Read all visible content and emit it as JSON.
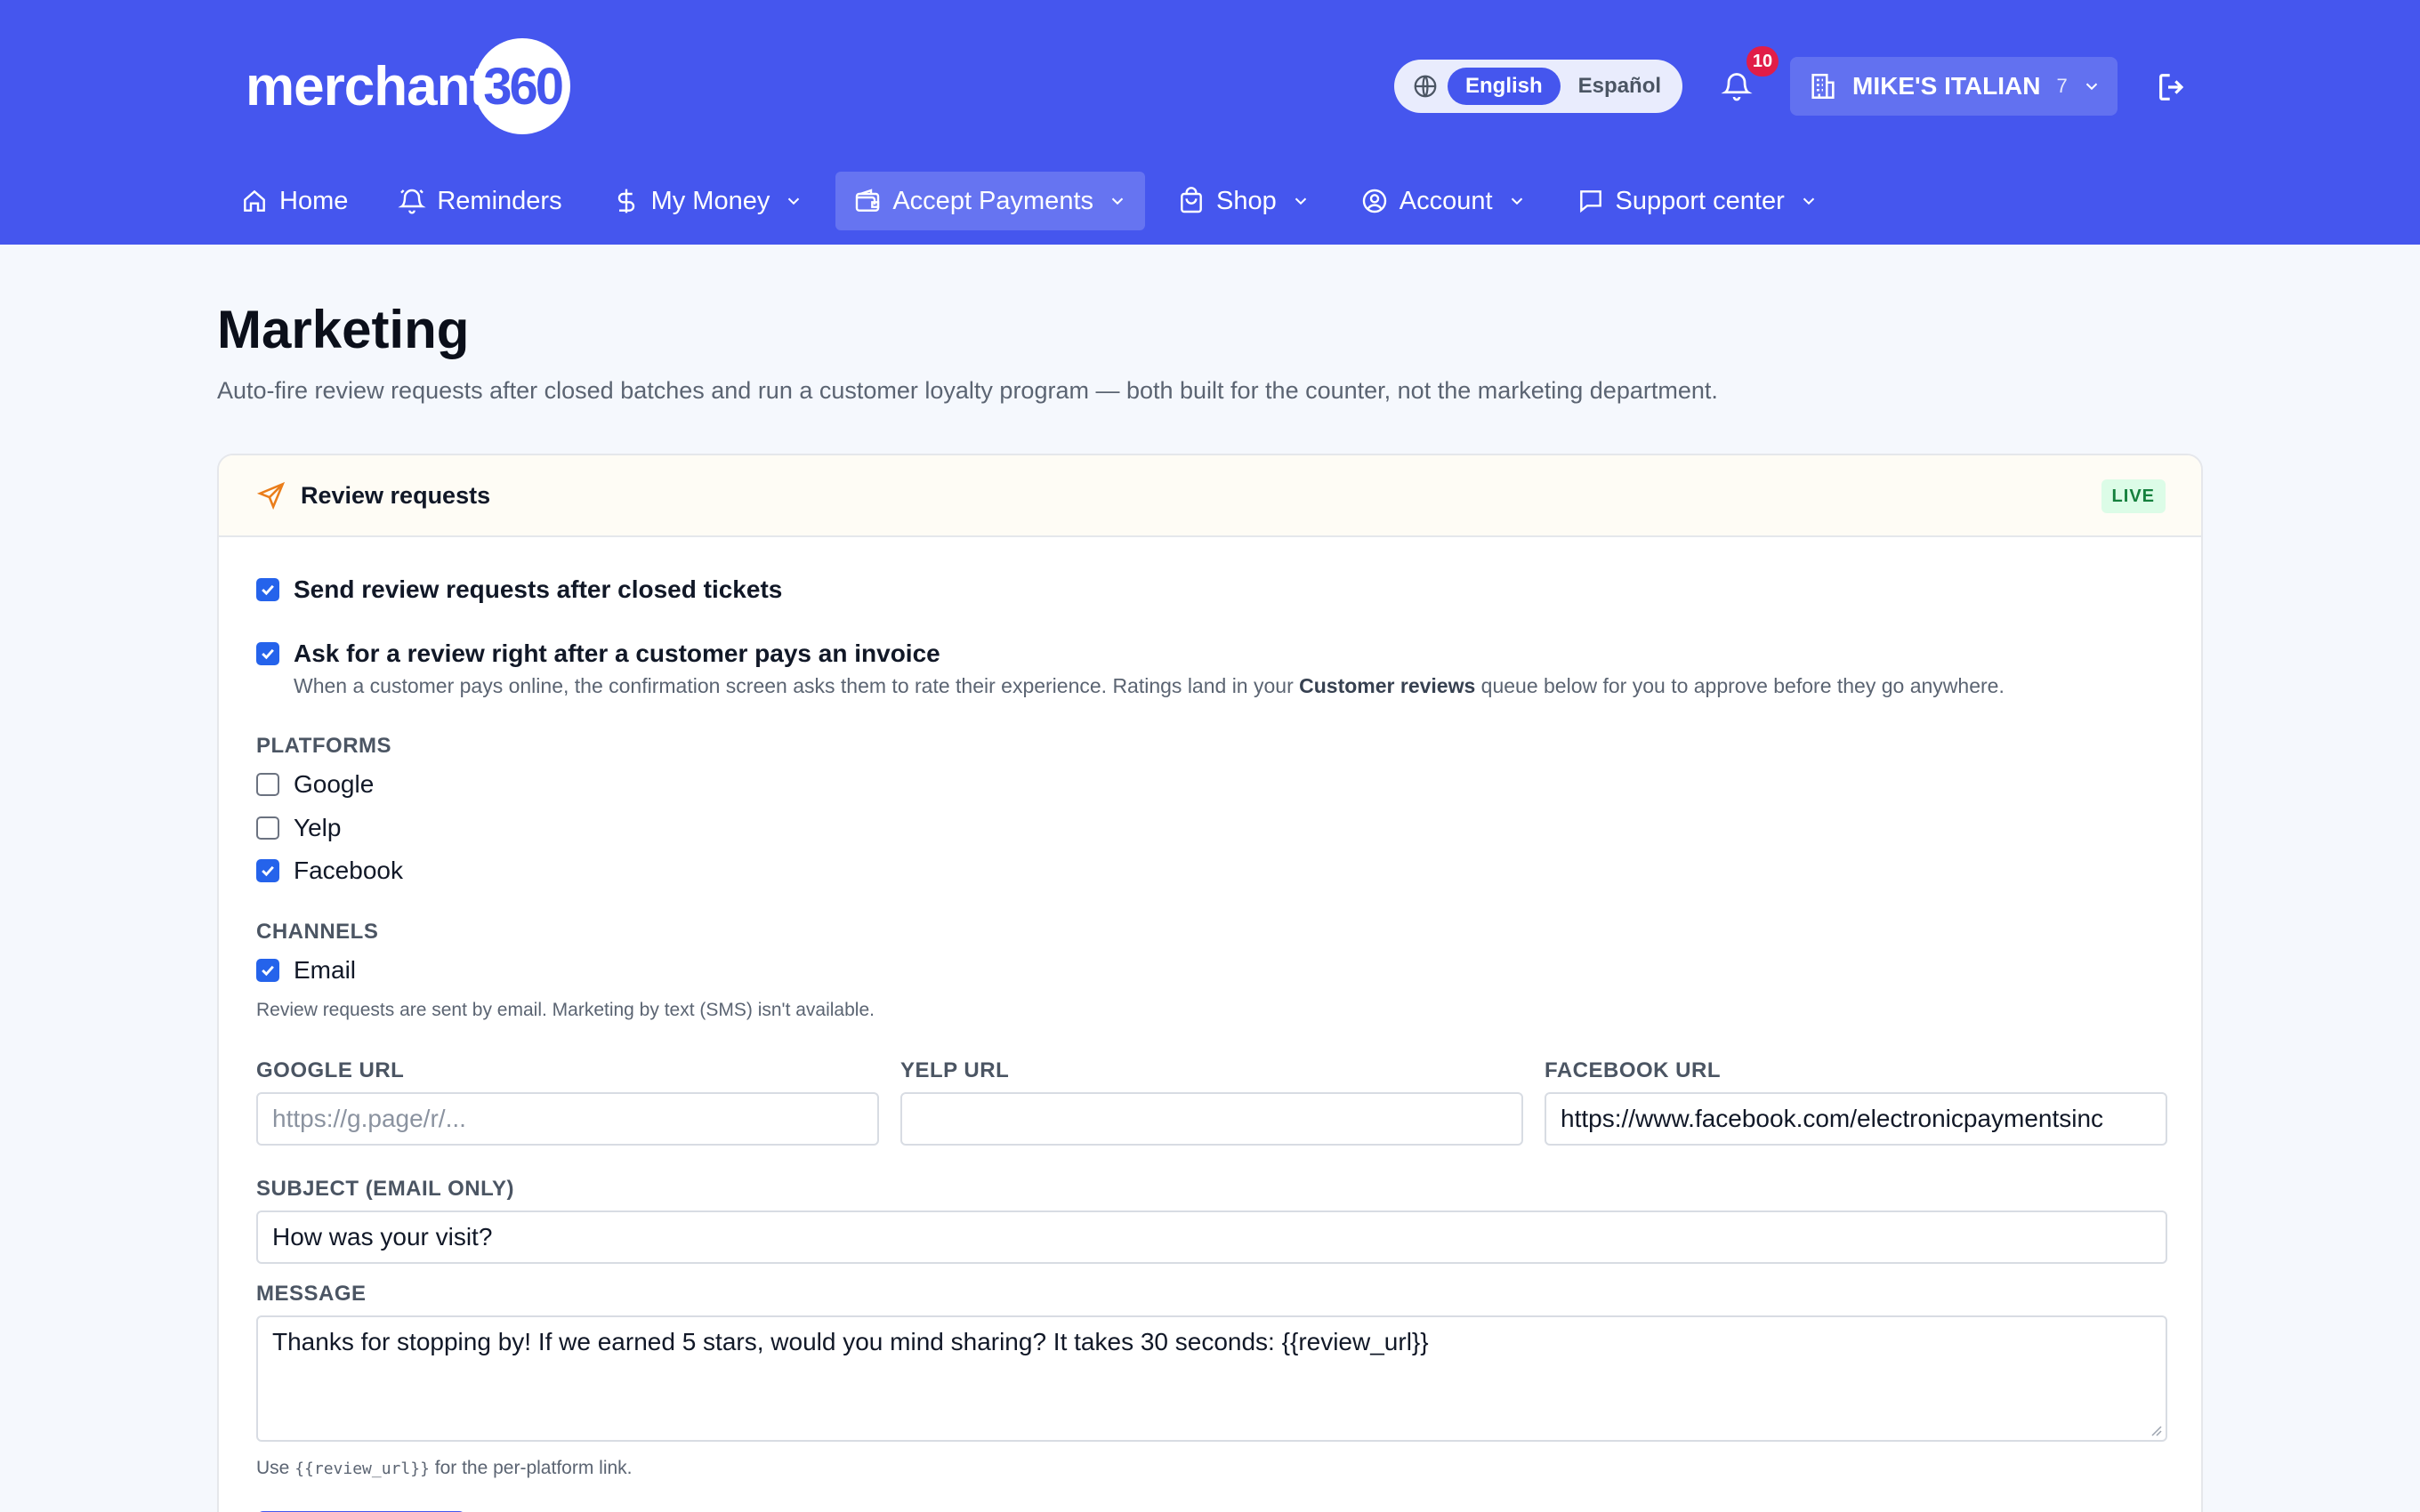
{
  "header": {
    "logo_text": "merchant",
    "logo_number": "360",
    "language": {
      "options": [
        "English",
        "Español"
      ],
      "selected": "English"
    },
    "notifications_count": "10",
    "store": {
      "name": "MIKE'S ITALIAN",
      "count": "7"
    },
    "icons": {
      "language": "globe-icon",
      "notifications": "bell-icon",
      "store": "building-icon",
      "logout": "logout-icon"
    }
  },
  "nav": {
    "items": [
      {
        "label": "Home",
        "icon": "home-icon",
        "dropdown": false
      },
      {
        "label": "Reminders",
        "icon": "bell-icon",
        "dropdown": false
      },
      {
        "label": "My Money",
        "icon": "dollar-icon",
        "dropdown": true
      },
      {
        "label": "Accept Payments",
        "icon": "wallet-icon",
        "dropdown": true,
        "active": true
      },
      {
        "label": "Shop",
        "icon": "bag-icon",
        "dropdown": true
      },
      {
        "label": "Account",
        "icon": "user-circle-icon",
        "dropdown": true
      },
      {
        "label": "Support center",
        "icon": "message-icon",
        "dropdown": true
      }
    ]
  },
  "page": {
    "title": "Marketing",
    "subtitle": "Auto-fire review requests after closed batches and run a customer loyalty program — both built for the counter, not the marketing department."
  },
  "review_card": {
    "title": "Review requests",
    "badge": "LIVE",
    "options": [
      {
        "label": "Send review requests after closed tickets",
        "checked": true
      },
      {
        "label": "Ask for a review right after a customer pays an invoice",
        "checked": true
      }
    ],
    "invoice_help_before": "When a customer pays online, the confirmation screen asks them to rate their experience. Ratings land in your ",
    "invoice_help_bold": "Customer reviews",
    "invoice_help_after": " queue below for you to approve before they go anywhere.",
    "platforms_heading": "PLATFORMS",
    "platforms": [
      {
        "label": "Google",
        "checked": false
      },
      {
        "label": "Yelp",
        "checked": false
      },
      {
        "label": "Facebook",
        "checked": true
      }
    ],
    "channels_heading": "CHANNELS",
    "channels": [
      {
        "label": "Email",
        "checked": true
      }
    ],
    "channels_note": "Review requests are sent by email. Marketing by text (SMS) isn't available.",
    "google_url": {
      "label": "GOOGLE URL",
      "value": "",
      "placeholder": "https://g.page/r/..."
    },
    "yelp_url": {
      "label": "YELP URL",
      "value": "",
      "placeholder": ""
    },
    "facebook_url": {
      "label": "FACEBOOK URL",
      "value": "https://www.facebook.com/electronicpaymentsinc",
      "placeholder": ""
    },
    "subject": {
      "label": "SUBJECT (EMAIL ONLY)",
      "value": "How was your visit?"
    },
    "message": {
      "label": "MESSAGE",
      "value": "Thanks for stopping by! If we earned 5 stars, would you mind sharing? It takes 30 seconds: {{review_url}}"
    },
    "message_hint_before": "Use ",
    "message_hint_code": "{{review_url}}",
    "message_hint_after": " for the per-platform link."
  },
  "colors": {
    "brand": "#4556ee",
    "checkbox": "#2563eb",
    "badge_bg": "#dcfce7",
    "badge_text": "#15803d",
    "alert": "#e11d48"
  }
}
